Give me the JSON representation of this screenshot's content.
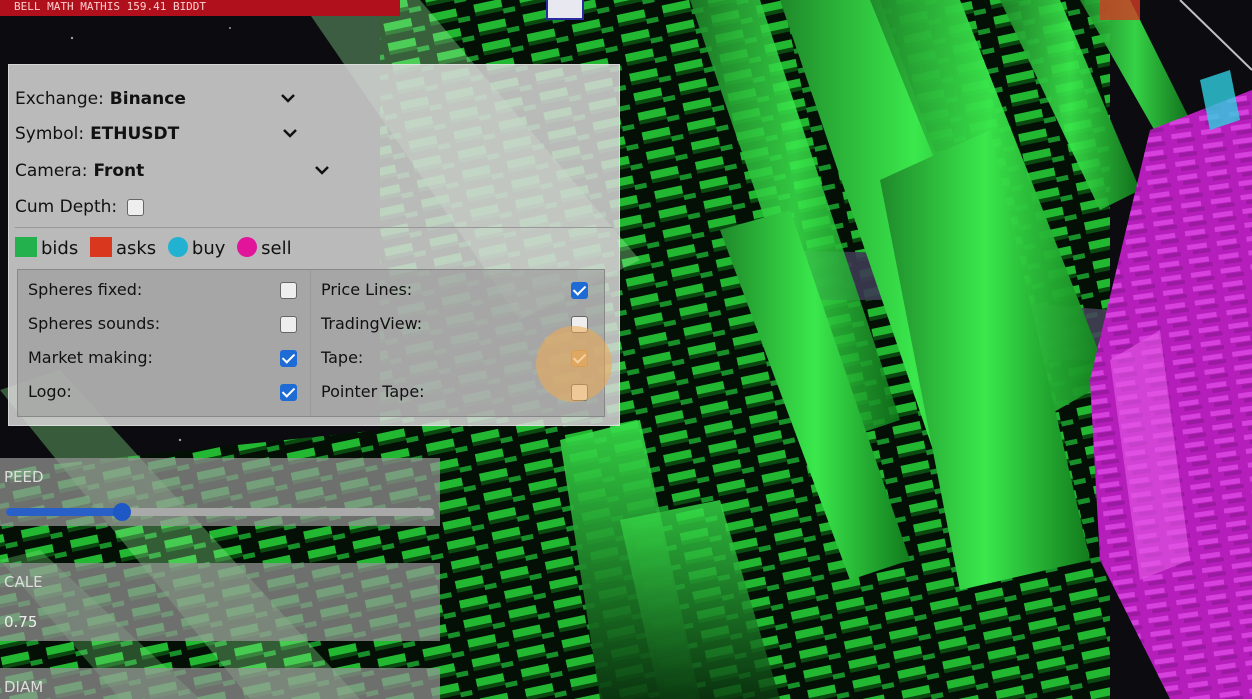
{
  "header": {
    "status_text": "BELL MATH MATHIS   159.41   BIDDT"
  },
  "dropdowns": [
    {
      "label": "Exchange:",
      "value": "Binance"
    },
    {
      "label": "Symbol:",
      "value": "ETHUSDT"
    },
    {
      "label": "Camera:",
      "value": "Front"
    }
  ],
  "cum_depth": {
    "label": "Cum Depth:",
    "checked": false
  },
  "legend": [
    {
      "label": "bids",
      "color": "#22b14c",
      "shape": "square"
    },
    {
      "label": "asks",
      "color": "#d9381e",
      "shape": "square"
    },
    {
      "label": "buy",
      "color": "#20b2d0",
      "shape": "circle"
    },
    {
      "label": "sell",
      "color": "#e0159a",
      "shape": "circle"
    }
  ],
  "options_left": [
    {
      "label": "Spheres fixed:",
      "checked": false
    },
    {
      "label": "Spheres sounds:",
      "checked": false
    },
    {
      "label": "Market making:",
      "checked": true
    },
    {
      "label": "Logo:",
      "checked": true
    }
  ],
  "options_right": [
    {
      "label": "Price Lines:",
      "checked": true
    },
    {
      "label": "TradingView:",
      "checked": false
    },
    {
      "label": "Tape:",
      "checked": true
    },
    {
      "label": "Pointer Tape:",
      "checked": false
    }
  ],
  "speed": {
    "label": "PEED",
    "value_fraction": 0.27
  },
  "scale": {
    "label": "CALE",
    "value": "0.75"
  },
  "diam": {
    "label": "DIAM"
  },
  "colors": {
    "bid_green": "#22c83a",
    "ask_magenta": "#c51ec8",
    "accent": "#1e6bd6"
  }
}
